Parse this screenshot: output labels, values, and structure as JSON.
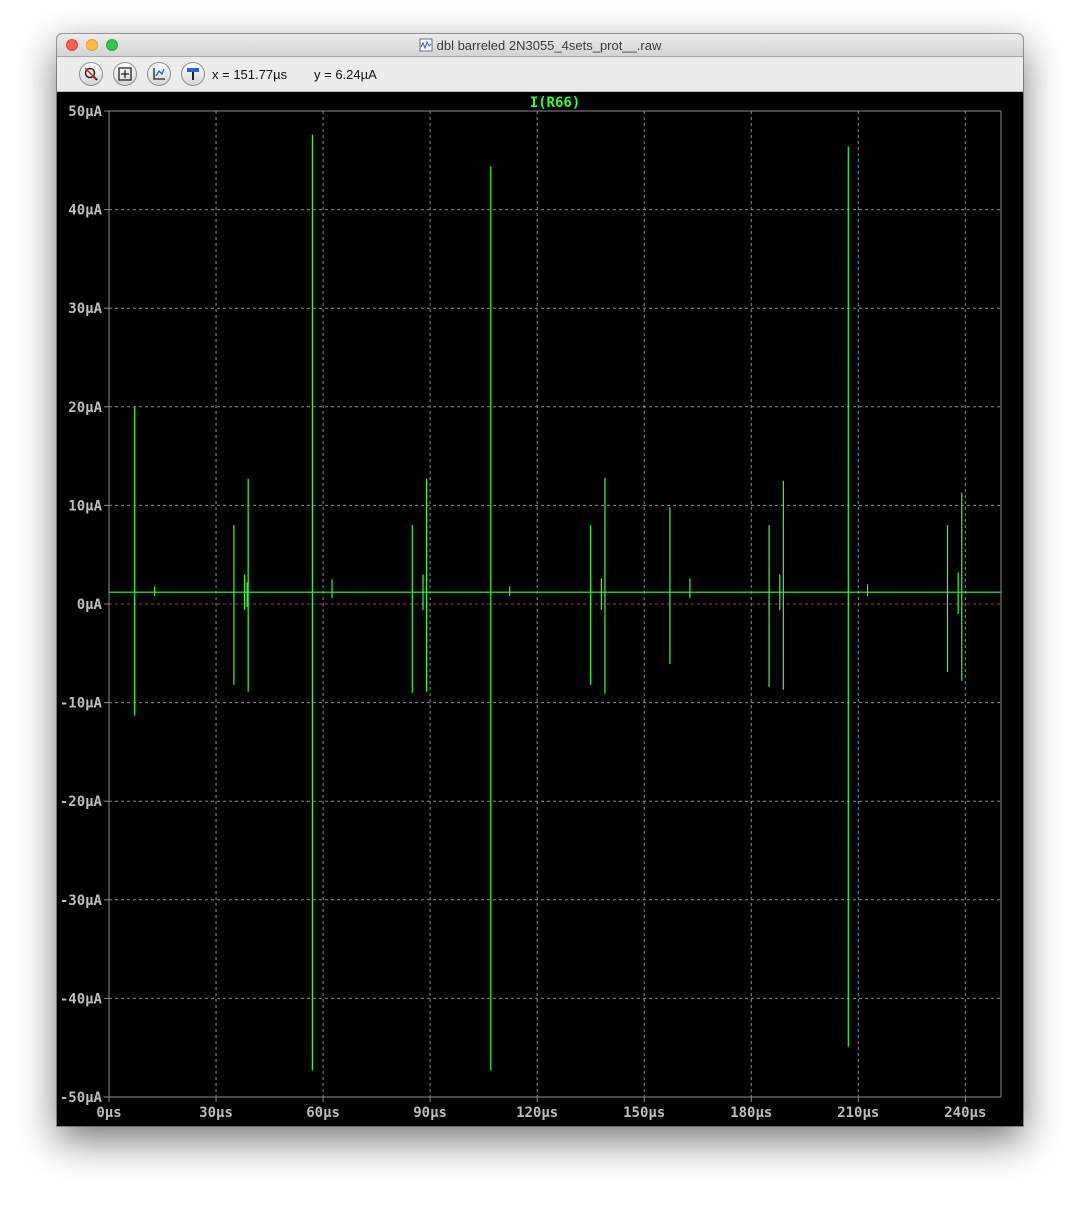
{
  "window": {
    "title": "dbl barreled 2N3055_4sets_prot__.raw"
  },
  "toolbar": {
    "buttons": [
      {
        "icon": "zoom-cancel-icon"
      },
      {
        "icon": "zoom-fit-icon"
      },
      {
        "icon": "cursor-axis-icon"
      },
      {
        "icon": "probe-icon"
      }
    ],
    "cursor_x": "x = 151.77µs",
    "cursor_y": "y = 6.24µA"
  },
  "colors": {
    "trace": "#33ff33",
    "grid": "#8c8c8c",
    "axis_text": "#bdbdbd",
    "zero_line": "#b03a2e",
    "background": "#000000"
  },
  "chart_data": {
    "type": "line",
    "title": "I(R66)",
    "xlabel": "",
    "ylabel": "",
    "xlim": [
      0,
      250
    ],
    "ylim": [
      -50,
      50
    ],
    "grid": true,
    "x_unit": "µs",
    "y_unit": "µA",
    "x_ticks": [
      "0µs",
      "30µs",
      "60µs",
      "90µs",
      "120µs",
      "150µs",
      "180µs",
      "210µs",
      "240µs"
    ],
    "y_ticks": [
      "50µA",
      "40µA",
      "30µA",
      "20µA",
      "10µA",
      "0µA",
      "-10µA",
      "-20µA",
      "-30µA",
      "-40µA",
      "-50µA"
    ],
    "baseline": 1.2,
    "series": [
      {
        "name": "I(R66)",
        "spikes": [
          {
            "x": 7.2,
            "max": 20.0,
            "min": -11.3
          },
          {
            "x": 12.8,
            "max": 1.8,
            "min": 0.8
          },
          {
            "x": 35.0,
            "max": 8.0,
            "min": -8.2
          },
          {
            "x": 38.0,
            "max": 3.0,
            "min": -0.6
          },
          {
            "x": 38.7,
            "max": 2.2,
            "min": -0.3
          },
          {
            "x": 39.0,
            "max": 12.7,
            "min": -8.9
          },
          {
            "x": 57.0,
            "max": 47.6,
            "min": -47.3
          },
          {
            "x": 62.5,
            "max": 2.5,
            "min": 0.6
          },
          {
            "x": 85.0,
            "max": 8.0,
            "min": -9.0
          },
          {
            "x": 88.0,
            "max": 3.0,
            "min": -0.6
          },
          {
            "x": 89.0,
            "max": 12.7,
            "min": -8.9
          },
          {
            "x": 107.0,
            "max": 44.4,
            "min": -47.3
          },
          {
            "x": 112.3,
            "max": 1.8,
            "min": 0.8
          },
          {
            "x": 135.0,
            "max": 8.0,
            "min": -8.2
          },
          {
            "x": 138.0,
            "max": 2.6,
            "min": -0.6
          },
          {
            "x": 139.0,
            "max": 12.8,
            "min": -9.1
          },
          {
            "x": 157.2,
            "max": 9.8,
            "min": -6.1
          },
          {
            "x": 162.8,
            "max": 2.6,
            "min": 0.6
          },
          {
            "x": 185.0,
            "max": 8.0,
            "min": -8.4
          },
          {
            "x": 188.0,
            "max": 3.0,
            "min": -0.6
          },
          {
            "x": 189.0,
            "max": 12.5,
            "min": -8.7
          },
          {
            "x": 207.2,
            "max": 46.4,
            "min": -44.9
          },
          {
            "x": 212.6,
            "max": 2.0,
            "min": 0.8
          },
          {
            "x": 235.0,
            "max": 8.0,
            "min": -6.9
          },
          {
            "x": 238.0,
            "max": 3.2,
            "min": -1.0
          },
          {
            "x": 239.0,
            "max": 11.3,
            "min": -7.8
          }
        ]
      }
    ]
  }
}
